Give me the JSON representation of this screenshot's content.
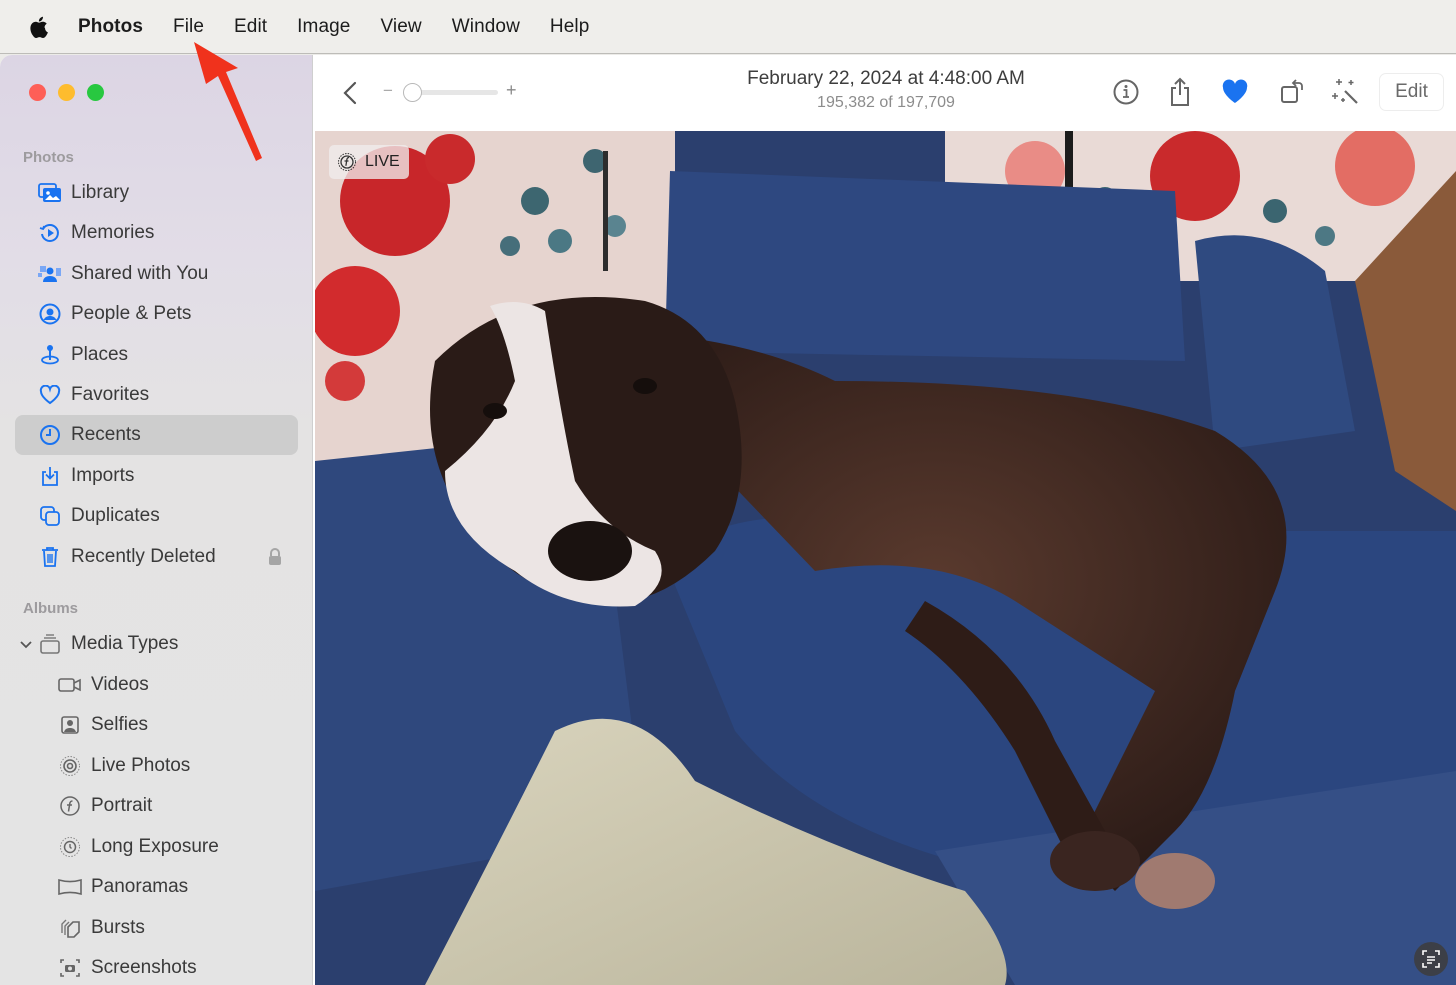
{
  "menubar": {
    "apple_icon": "apple-logo-icon",
    "items": [
      "Photos",
      "File",
      "Edit",
      "Image",
      "View",
      "Window",
      "Help"
    ]
  },
  "window": {
    "traffic_lights": {
      "close": "#fe5f57",
      "minimize": "#febc2e",
      "maximize": "#28c840"
    }
  },
  "sidebar": {
    "sections": [
      {
        "label": "Photos",
        "items": [
          {
            "label": "Library",
            "icon": "library-icon"
          },
          {
            "label": "Memories",
            "icon": "memories-icon"
          },
          {
            "label": "Shared with You",
            "icon": "shared-with-you-icon"
          },
          {
            "label": "People & Pets",
            "icon": "people-icon"
          },
          {
            "label": "Places",
            "icon": "places-pin-icon"
          },
          {
            "label": "Favorites",
            "icon": "heart-icon"
          },
          {
            "label": "Recents",
            "icon": "clock-icon",
            "selected": true
          },
          {
            "label": "Imports",
            "icon": "import-icon"
          },
          {
            "label": "Duplicates",
            "icon": "duplicates-icon"
          },
          {
            "label": "Recently Deleted",
            "icon": "trash-icon",
            "locked": true
          }
        ]
      },
      {
        "label": "Albums",
        "items": [
          {
            "label": "Media Types",
            "icon": "stack-icon",
            "expanded": true
          },
          {
            "label": "Videos",
            "icon": "video-camera-icon"
          },
          {
            "label": "Selfies",
            "icon": "selfie-icon"
          },
          {
            "label": "Live Photos",
            "icon": "live-photo-icon"
          },
          {
            "label": "Portrait",
            "icon": "portrait-f-icon"
          },
          {
            "label": "Long Exposure",
            "icon": "long-exposure-icon"
          },
          {
            "label": "Panoramas",
            "icon": "panorama-icon"
          },
          {
            "label": "Bursts",
            "icon": "bursts-icon"
          },
          {
            "label": "Screenshots",
            "icon": "screenshot-icon"
          }
        ]
      }
    ]
  },
  "toolbar": {
    "zoom_minus": "−",
    "zoom_plus": "+",
    "zoom_level": 0,
    "title": "February 22, 2024 at 4:48:00 AM",
    "subtitle": "195,382 of 197,709",
    "favorite_active": true,
    "accent_color": "#1a73f0",
    "edit_label": "Edit"
  },
  "photo": {
    "live_badge": "LIVE",
    "description": "Black and white dog lying on blue cushions"
  }
}
